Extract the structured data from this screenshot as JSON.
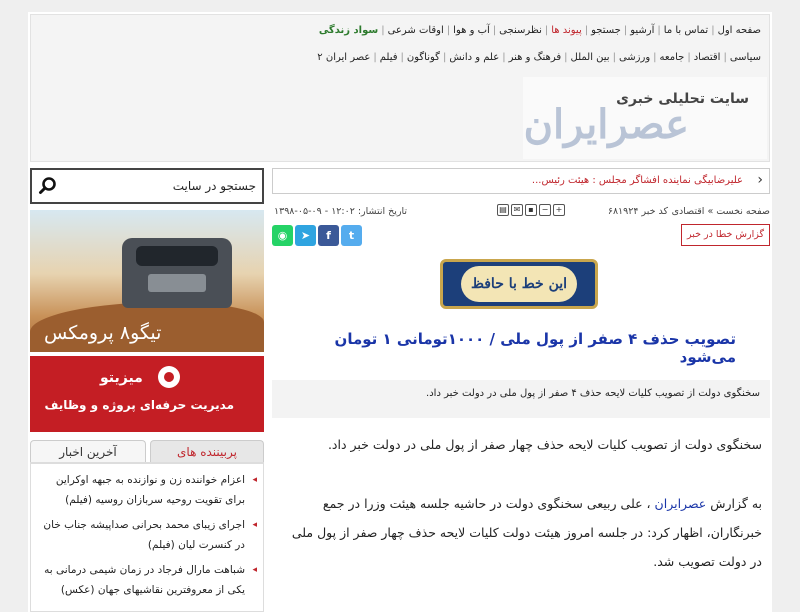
{
  "nav": {
    "row1": [
      {
        "label": "صفحه اول",
        "style": ""
      },
      {
        "label": "تماس با ما",
        "style": ""
      },
      {
        "label": "آرشیو",
        "style": ""
      },
      {
        "label": "جستجو",
        "style": ""
      },
      {
        "label": "پیوند ها",
        "style": "red"
      },
      {
        "label": "نظرسنجی",
        "style": ""
      },
      {
        "label": "آب و هوا",
        "style": ""
      },
      {
        "label": "اوقات شرعی",
        "style": ""
      },
      {
        "label": "سواد زندگی",
        "style": "green"
      }
    ],
    "row2": [
      {
        "label": "سیاسی"
      },
      {
        "label": "اقتصاد"
      },
      {
        "label": "جامعه"
      },
      {
        "label": "ورزشی"
      },
      {
        "label": "بین الملل"
      },
      {
        "label": "فرهنگ و هنر"
      },
      {
        "label": "علم و دانش"
      },
      {
        "label": "گوناگون"
      },
      {
        "label": "فیلم"
      },
      {
        "label": "عصر ایران ۲"
      }
    ]
  },
  "logo": {
    "tagline": "سایت تحلیلی خبری",
    "name": "عصرایران"
  },
  "ticker": {
    "text": "علیرضابیگی نماینده افشاگر مجلس : هیئت رئیس..."
  },
  "article_meta": {
    "breadcrumb": "صفحه نخست » اقتصادی",
    "news_code": "کد خبر ۶۸۱۹۲۴",
    "pubdate": "تاریخ انتشار: ۱۲:۰۲ - ۰۹-۰۵-۱۳۹۸"
  },
  "share": {
    "buttons": [
      {
        "icon": "whatsapp-icon",
        "glyph": "◉",
        "color": "#25d366"
      },
      {
        "icon": "telegram-icon",
        "glyph": "➤",
        "color": "#2fa4e0"
      },
      {
        "icon": "facebook-icon",
        "glyph": "f",
        "color": "#3b5998"
      },
      {
        "icon": "twitter-icon",
        "glyph": "t",
        "color": "#55acee"
      }
    ]
  },
  "report_button": "گزارش خطا در خبر",
  "calligraphy_text": "این خط با حافظ",
  "article": {
    "title": "تصویب حذف ۴ صفر از پول ملی / ۱۰۰۰تومانی ۱ تومان می‌شود",
    "lead": "سخنگوی دولت از تصویب کلیات لایحه حذف ۴ صفر از پول ملی در دولت خبر داد.",
    "paragraph1": "سخنگوی دولت از تصویب کلیات لایحه حذف چهار صفر از پول ملی در دولت خبر داد.",
    "paragraph2_prefix": "به گزارش ",
    "paragraph2_link": "عصرایران",
    "paragraph2_rest": " ، علی ربیعی سخنگوی دولت در حاشیه جلسه هیئت وزرا در جمع خبرنگاران، اظهار کرد: در جلسه امروز هیئت دولت کلیات لایحه حذف چهار صفر از پول ملی در دولت تصویب شد."
  },
  "search": {
    "placeholder": "جستجو در سایت"
  },
  "ad1": {
    "text": "تیگو۸ پرومکس"
  },
  "ad2": {
    "brand": "میزیتو",
    "tagline": "مدیریت حرفه‌ای پروژه و وظایف"
  },
  "tabs": {
    "popular": "پربیننده های",
    "latest": "آخرین اخبار"
  },
  "popular_news": [
    "اعزام خواننده زن و نوازنده به جبهه اوکراین برای تقویت روحیه سربازان روسیه (فیلم)",
    "اجرای زیبای محمد بحرانی صداپیشه جناب خان در کنسرت لیان (فیلم)",
    "شباهت مارال فرجاد در زمان شیمی درمانی به یکی از معروفترین نقاشیهای جهان (عکس)"
  ]
}
